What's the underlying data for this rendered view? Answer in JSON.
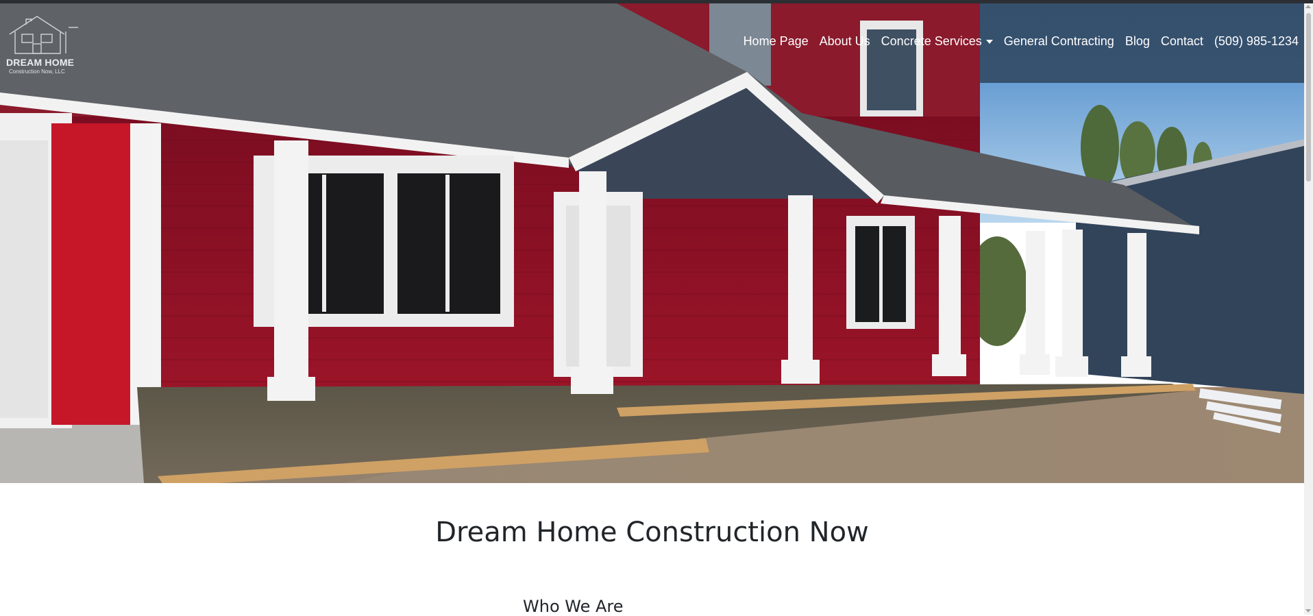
{
  "brand": {
    "name": "DREAM HOME",
    "subtitle": "Construction Now, LLC"
  },
  "nav": {
    "items": [
      {
        "label": "Home Page"
      },
      {
        "label": "About Us"
      },
      {
        "label": "Concrete Services"
      },
      {
        "label": "General Contracting"
      },
      {
        "label": "Blog"
      },
      {
        "label": "Contact"
      },
      {
        "label": "(509) 985-1234"
      }
    ]
  },
  "hero": {
    "image_description": "Red house with white porch columns and freshly poured concrete porch"
  },
  "main": {
    "title": "Dream Home Construction Now",
    "section_heading": "Who We Are"
  },
  "icons": {
    "dropdown": "caret-down-icon",
    "logo": "house-outline-icon"
  },
  "colors": {
    "nav_bg": "#344c66",
    "siding_red": "#8a1024",
    "trim_white": "#f1f1f1",
    "roof_gray": "#5e6166",
    "concrete": "#6b6450"
  }
}
